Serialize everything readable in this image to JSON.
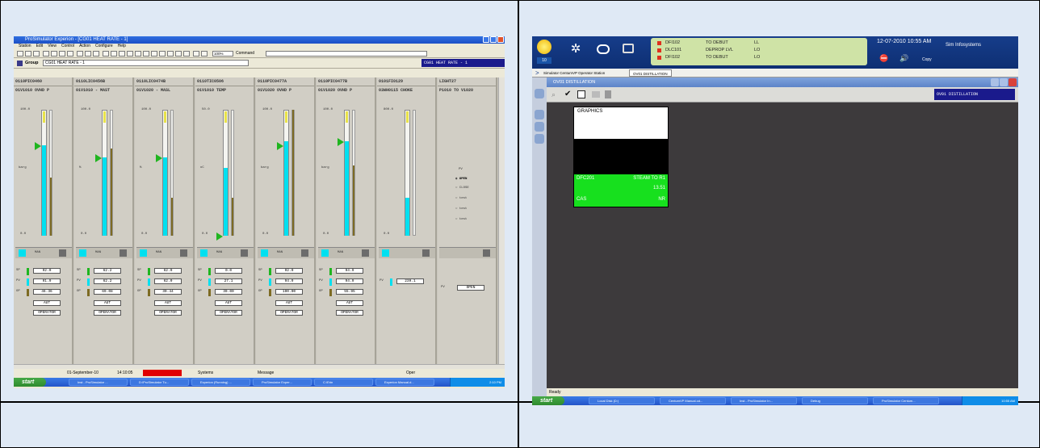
{
  "left_screen": {
    "title": "ProSimulator Experion - [CG01 HEAT RATE - 1]",
    "menu": [
      "Station",
      "Edit",
      "View",
      "Control",
      "Action",
      "Configure",
      "Help"
    ],
    "zoom": "100%",
    "command_label": "Command",
    "group_label": "Group",
    "group_value": "CG01 HEAT RATE - 1",
    "header_right": "CG01 HEAT RATE - 1",
    "faceplates": [
      {
        "tag": "0110PIC0460",
        "desc": "01V1010 OVHD P",
        "scale_top": "100.0",
        "scale_bottom": "0.0",
        "unit": "barg",
        "mode": "MAN",
        "sp": "92.0",
        "pv": "91.9",
        "op": "46.36",
        "mode_val": "AUT",
        "owner": "OPERATOR",
        "pv_frac": 0.72,
        "sp_frac": 0.72,
        "op_frac": 0.46
      },
      {
        "tag": "0110LIC0456B",
        "desc": "01V1010 - MAST",
        "scale_top": "100.0",
        "scale_bottom": "0.0",
        "unit": "%",
        "mode": "MAN",
        "sp": "62.2",
        "pv": "62.2",
        "op": "69.08",
        "mode_val": "AUT",
        "owner": "OPERATOR",
        "pv_frac": 0.62,
        "sp_frac": 0.62,
        "op_frac": 0.69
      },
      {
        "tag": "0110LIC0474B",
        "desc": "01V1020 - MASL",
        "scale_top": "100.0",
        "scale_bottom": "0.0",
        "unit": "%",
        "mode": "MAN",
        "sp": "62.0",
        "pv": "62.0",
        "op": "30.44",
        "mode_val": "AUT",
        "owner": "OPERATOR",
        "pv_frac": 0.62,
        "sp_frac": 0.62,
        "op_frac": 0.3
      },
      {
        "tag": "0110TIC0506",
        "desc": "01V1010 TEMP",
        "scale_top": "50.0",
        "scale_bottom": "0.0",
        "unit": "oC",
        "mode": "MAN",
        "sp": "0.0",
        "pv": "27.1",
        "op": "30.00",
        "mode_val": "AUT",
        "owner": "OPERATOR",
        "pv_frac": 0.54,
        "sp_frac": 0.0,
        "op_frac": 0.3
      },
      {
        "tag": "0110PIC0477A",
        "desc": "01V1020 OVHD P",
        "scale_top": "100.0",
        "scale_bottom": "0.0",
        "unit": "barg",
        "mode": "MAN",
        "sp": "92.0",
        "pv": "94.9",
        "op": "100.00",
        "mode_val": "AUT",
        "owner": "OPERATOR",
        "pv_frac": 0.75,
        "sp_frac": 0.72,
        "op_frac": 1.0
      },
      {
        "tag": "0110PIC0477B",
        "desc": "01V1020 OVHD P",
        "scale_top": "100.0",
        "scale_bottom": "0.0",
        "unit": "barg",
        "mode": "MAN",
        "sp": "94.9",
        "pv": "94.9",
        "op": "55.95",
        "mode_val": "AUT",
        "owner": "OPERATOR",
        "pv_frac": 0.75,
        "sp_frac": 0.75,
        "op_frac": 0.56
      },
      {
        "tag": "0101FI0129",
        "desc": "03WH0115 CHOKE",
        "scale_top": "800.0",
        "scale_bottom": "0.0",
        "unit": "",
        "mode": "",
        "sp": "",
        "pv": "239.1",
        "op": "",
        "mode_val": "",
        "owner": "",
        "pv_frac": 0.3,
        "sp_frac": 0,
        "op_frac": 0
      },
      {
        "tag": "LIGHT27",
        "desc": "P1010 TO V1020",
        "pv_label": "PV",
        "options": [
          "OPEN",
          "CLOSE",
          "test",
          "test",
          "test"
        ],
        "pv": "OPEN"
      }
    ],
    "status": {
      "date": "01-September-10",
      "time": "14:10:05",
      "systems": "Systems",
      "message": "Message",
      "oper": "Oper"
    },
    "taskbar": {
      "start": "start",
      "items": [
        "Inst - ProSimulator ...",
        "D:\\ProSimulator Tu...",
        "Experion (Running) ...",
        "ProSimulator Exper...",
        "C:\\Erin",
        "Experion Manual.d..."
      ],
      "clock": "2:10 PM"
    }
  },
  "right_screen": {
    "alarms": [
      {
        "tag": "DFI102",
        "desc": "TO DEBUT",
        "level": "LL"
      },
      {
        "tag": "DLC101",
        "desc": "DEPROP LVL",
        "level": "LO"
      },
      {
        "tag": "DFI102",
        "desc": "TO DEBUT",
        "level": "LO"
      }
    ],
    "badge": "10",
    "datetime": "12-07-2010 10:55 AM",
    "vendor": "Sim Infosystems",
    "copy": "Copy",
    "tabs": [
      "Simulator CentumVP Operator Station",
      "OV01 DISTILLATION"
    ],
    "window_title": "OV01 DISTILLATION",
    "title_tag": "OV01 DISTILLATION",
    "graphics_label": "GRAPHICS",
    "tile": {
      "tag": "DFC201",
      "desc": "STEAM TO R1",
      "value": "13.51",
      "mode": "CAS",
      "status": "NR"
    },
    "status": "Ready",
    "taskbar": {
      "start": "start",
      "items": [
        "Local Disk (D:)",
        "CentumVP Manual.od...",
        "Inst - ProSimulator In...",
        "Debug",
        "ProSimulator Centum..."
      ],
      "clock": "10:55 AM"
    }
  },
  "colors": {
    "cyan": "#00e0f0",
    "olive": "#7d6b23",
    "green_marker": "#1fb51f",
    "tile_green": "#17e01e",
    "dark_bg": "#3d3a3c"
  }
}
